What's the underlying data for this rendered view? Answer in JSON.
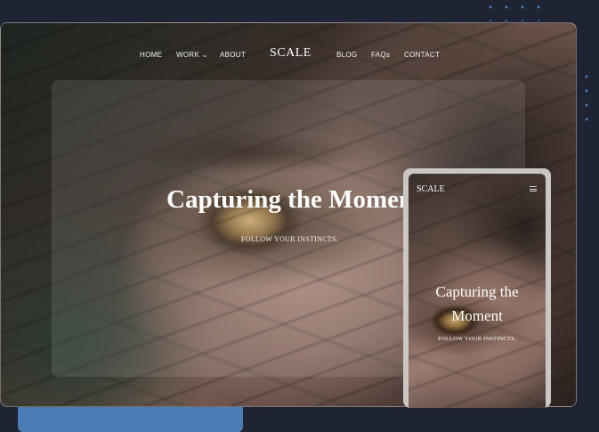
{
  "nav": {
    "items": [
      {
        "label": "HOME"
      },
      {
        "label": "WORK",
        "has_dropdown": true
      },
      {
        "label": "ABOUT"
      },
      {
        "label": "BLOG"
      },
      {
        "label": "FAQs"
      },
      {
        "label": "CONTACT"
      }
    ],
    "logo": "SCALE",
    "dropdown_icon": "chevron-down-icon"
  },
  "hero": {
    "title": "Capturing the Moment",
    "subtitle": "FOLLOW YOUR INSTINCTS."
  },
  "mobile": {
    "logo": "SCALE",
    "menu_icon": "hamburger-menu-icon",
    "title": "Capturing the Moment",
    "subtitle": "FOLLOW YOUR INSTINCTS."
  },
  "colors": {
    "page_background": "#1e2433",
    "accent_blue": "#4b7cb3",
    "text": "#ffffff"
  }
}
